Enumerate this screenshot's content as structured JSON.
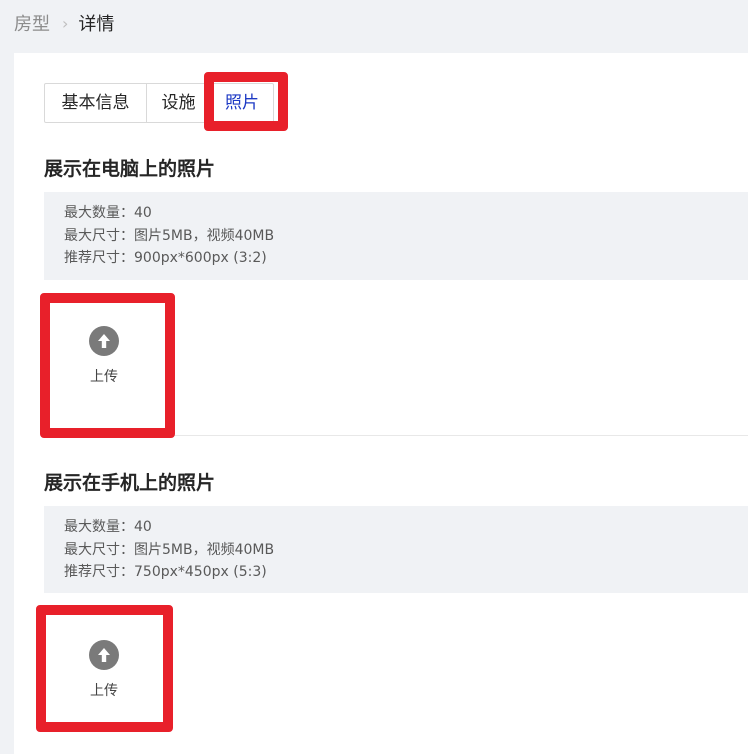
{
  "breadcrumb": {
    "prev": "房型",
    "separator": ">",
    "current": "详情"
  },
  "tabs": [
    {
      "label": "基本信息"
    },
    {
      "label": "设施"
    },
    {
      "label": "照片"
    }
  ],
  "active_tab_index": 2,
  "sections": [
    {
      "title": "展示在电脑上的照片",
      "info": [
        "最大数量：40",
        "最大尺寸：图片5MB，视频40MB",
        "推荐尺寸：900px*600px (3:2)"
      ],
      "upload_label": "上传"
    },
    {
      "title": "展示在手机上的照片",
      "info": [
        "最大数量：40",
        "最大尺寸：图片5MB，视频40MB",
        "推荐尺寸：750px*450px (5:3)"
      ],
      "upload_label": "上传"
    }
  ],
  "colors": {
    "accent": "#1d39c4",
    "highlight": "#e8202a",
    "background": "#f0f2f5"
  },
  "icons": {
    "upload": "upload-arrow-circle-icon",
    "breadcrumb_separator": "chevron-right-icon"
  }
}
